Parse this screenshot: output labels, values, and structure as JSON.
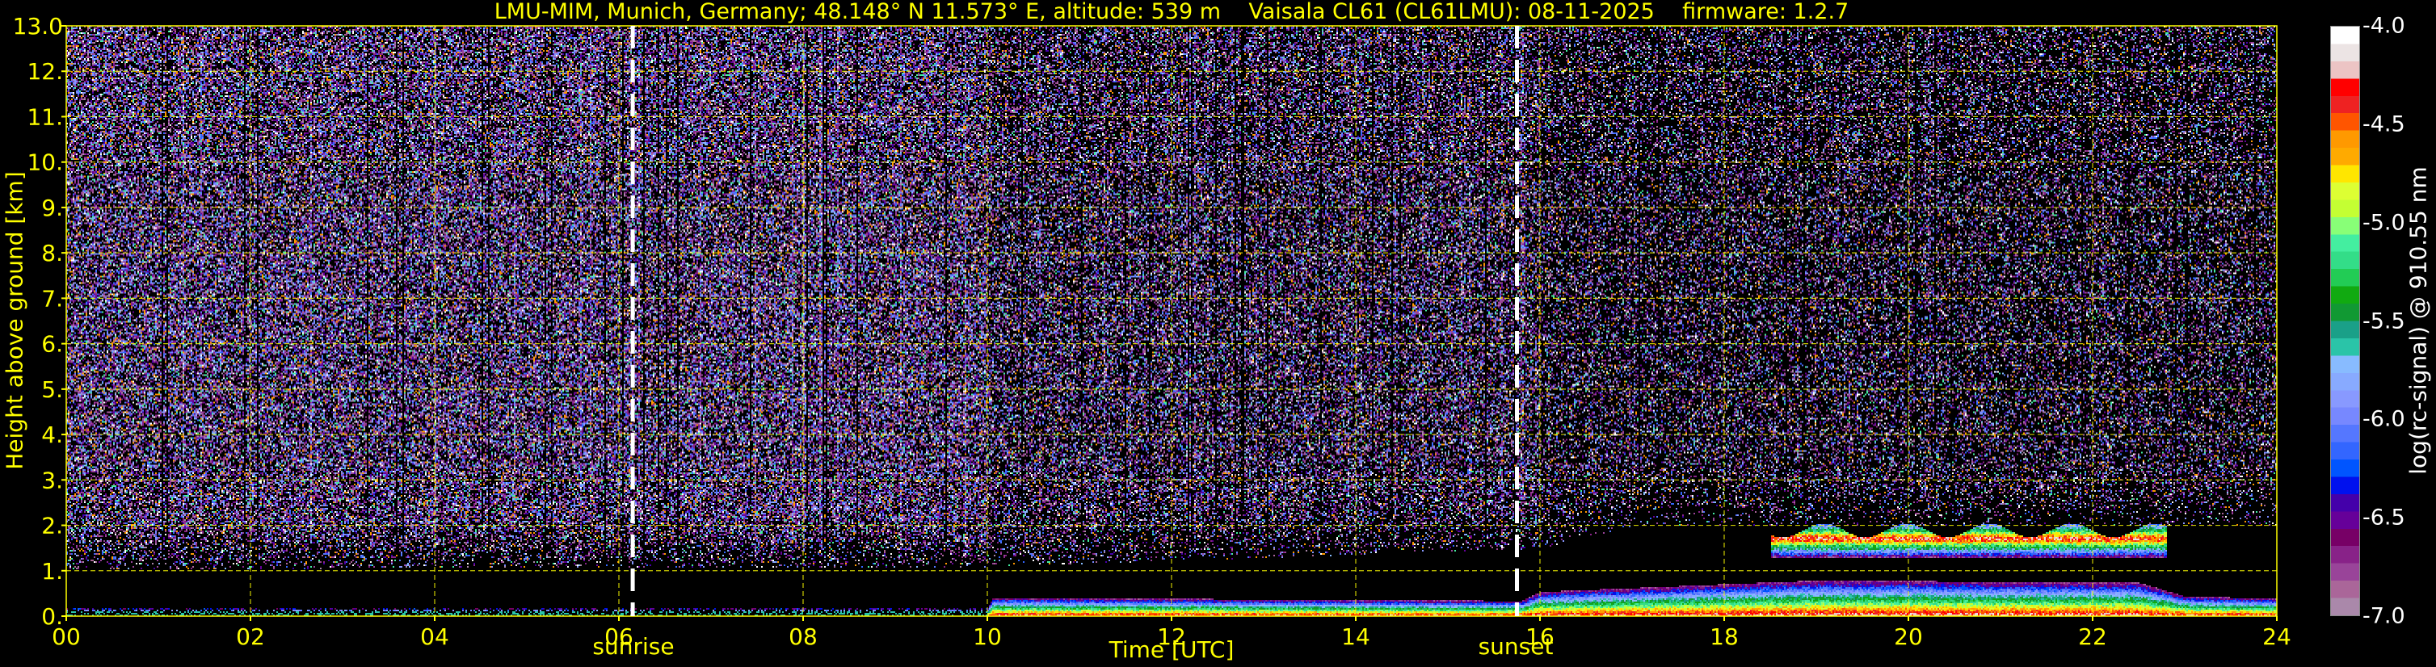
{
  "title": "LMU-MIM, Munich, Germany; 48.148° N 11.573° E, altitude: 539 m    Vaisala CL61 (CL61LMU): 08-11-2025    firmware: 1.2.7",
  "chart_data": {
    "type": "heatmap",
    "title": "LMU-MIM, Munich, Germany; 48.148° N 11.573° E, altitude: 539 m    Vaisala CL61 (CL61LMU): 08-11-2025    firmware: 1.2.7",
    "xlabel": "Time [UTC]",
    "ylabel": "Height above ground [km]",
    "xlim": [
      0,
      24
    ],
    "ylim": [
      0,
      13
    ],
    "x_ticks": [
      "00",
      "02",
      "04",
      "06",
      "08",
      "10",
      "12",
      "14",
      "16",
      "18",
      "20",
      "22",
      "24"
    ],
    "y_ticks": [
      "0.",
      "1.",
      "2.",
      "3.",
      "4.",
      "5.",
      "6.",
      "7.",
      "8.",
      "9.",
      "10.",
      "11.",
      "12.",
      "13.0"
    ],
    "grid": true,
    "events": [
      {
        "label": "sunrise",
        "time": 6.15
      },
      {
        "label": "sunset",
        "time": 15.75
      }
    ],
    "colorbar": {
      "label": "log(rc-signal) @ 910.55 nm",
      "range": [
        -7.0,
        -4.0
      ],
      "ticks": [
        "-4.0",
        "-4.5",
        "-5.0",
        "-5.5",
        "-6.0",
        "-6.5",
        "-7.0"
      ],
      "colors": [
        "#ffffff",
        "#ece4e4",
        "#ecc4c4",
        "#ff0000",
        "#ee2222",
        "#ff5500",
        "#ff9900",
        "#ffaa00",
        "#ffe600",
        "#ddff33",
        "#c4ff33",
        "#88ff77",
        "#44eea0",
        "#33dd88",
        "#22cc55",
        "#11aa11",
        "#119933",
        "#1aa088",
        "#2ac4a8",
        "#88bbff",
        "#88aaff",
        "#8899ff",
        "#7788ff",
        "#5577ff",
        "#3366ff",
        "#0055ff",
        "#0011ee",
        "#4400aa",
        "#660099",
        "#770066",
        "#882288",
        "#994499",
        "#aa6699",
        "#aa88aa"
      ]
    },
    "features": {
      "noise_floor_km": [
        [
          0,
          1.05
        ],
        [
          10,
          1.1
        ],
        [
          16,
          1.5
        ],
        [
          17,
          2.0
        ],
        [
          24,
          2.0
        ]
      ],
      "boundary_layer_top_km": [
        [
          0,
          0.2
        ],
        [
          10,
          0.2
        ],
        [
          10.05,
          0.42
        ],
        [
          15.8,
          0.35
        ],
        [
          16,
          0.55
        ],
        [
          19,
          0.8
        ],
        [
          22.5,
          0.75
        ],
        [
          23,
          0.45
        ],
        [
          24,
          0.4
        ]
      ],
      "cloud_layer_km": [
        {
          "start": 18.5,
          "end": 22.8,
          "base": 1.3,
          "top": 1.9
        }
      ]
    }
  }
}
